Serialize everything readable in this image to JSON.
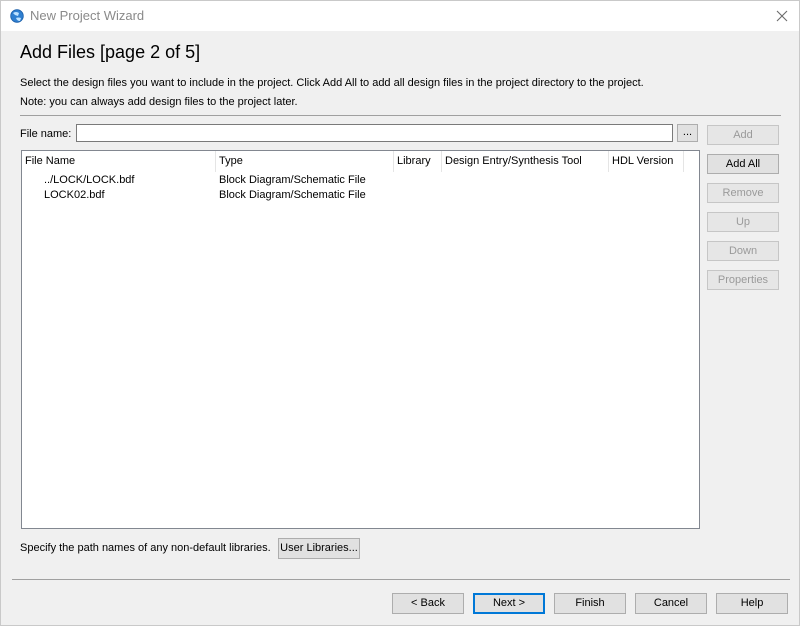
{
  "window": {
    "title": "New Project Wizard"
  },
  "header": {
    "title": "Add Files [page 2 of 5]",
    "description": "Select the design files you want to include in the project. Click Add All to add all design files in the project directory to the project.",
    "note": "Note: you can always add design files to the project later."
  },
  "file_name": {
    "label": "File name:",
    "value": "",
    "browse_label": "..."
  },
  "side_buttons": [
    {
      "label": "Add",
      "enabled": false
    },
    {
      "label": "Add All",
      "enabled": true
    },
    {
      "label": "Remove",
      "enabled": false
    },
    {
      "label": "Up",
      "enabled": false
    },
    {
      "label": "Down",
      "enabled": false
    },
    {
      "label": "Properties",
      "enabled": false
    }
  ],
  "table": {
    "columns": [
      "File Name",
      "Type",
      "Library",
      "Design Entry/Synthesis Tool",
      "HDL Version"
    ],
    "rows": [
      [
        "../LOCK/LOCK.bdf",
        "Block Diagram/Schematic File",
        "",
        "",
        ""
      ],
      [
        "LOCK02.bdf",
        "Block Diagram/Schematic File",
        "",
        "",
        ""
      ]
    ]
  },
  "libraries": {
    "note": "Specify the path names of any non-default libraries.",
    "button_label": "User Libraries..."
  },
  "footer_buttons": {
    "back": "< Back",
    "next": "Next >",
    "finish": "Finish",
    "cancel": "Cancel",
    "help": "Help"
  }
}
